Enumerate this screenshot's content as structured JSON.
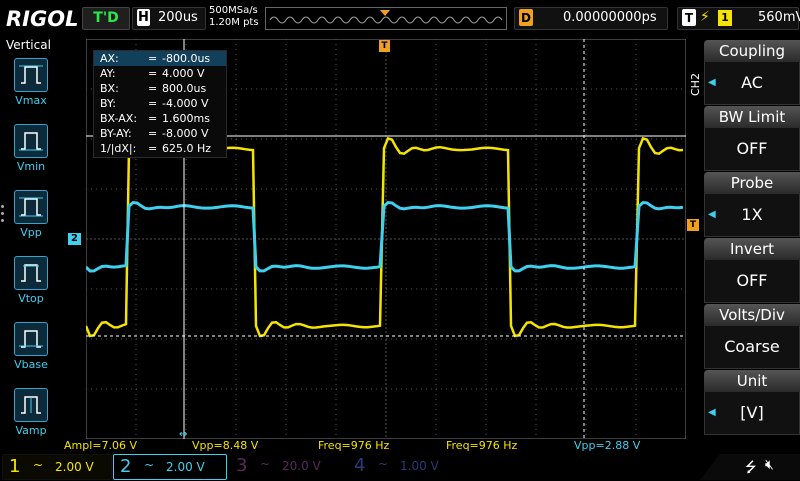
{
  "topbar": {
    "brand": "RIGOL",
    "trigger_status": "T'D",
    "horizontal_key": "H",
    "timebase": "200us",
    "sample_rate": "500MSa/s",
    "memory_depth": "1.20M pts",
    "delay_key": "D",
    "delay_value": "0.00000000ps",
    "trigger_key": "T",
    "trigger_source": "1",
    "trigger_level": "560mV"
  },
  "left_menu": {
    "title": "Vertical",
    "items": [
      {
        "label": "Vmax",
        "icon": "vmax-icon"
      },
      {
        "label": "Vmin",
        "icon": "vmin-icon"
      },
      {
        "label": "Vpp",
        "icon": "vpp-icon"
      },
      {
        "label": "Vtop",
        "icon": "vtop-icon"
      },
      {
        "label": "Vbase",
        "icon": "vbase-icon"
      },
      {
        "label": "Vamp",
        "icon": "vamp-icon"
      }
    ]
  },
  "cursor_table": {
    "rows": [
      {
        "k": "AX:",
        "v": "-800.0us"
      },
      {
        "k": "AY:",
        "v": "4.000 V"
      },
      {
        "k": "BX:",
        "v": "800.0us"
      },
      {
        "k": "BY:",
        "v": "-4.000 V"
      },
      {
        "k": "BX-AX:",
        "v": "1.600ms"
      },
      {
        "k": "BY-AY:",
        "v": "-8.000 V"
      },
      {
        "k": "1/|dX|:",
        "v": "625.0 Hz"
      }
    ],
    "eq": "="
  },
  "markers": {
    "ch2_marker": "2",
    "trigger_marker": "T"
  },
  "measurements": [
    {
      "text": "Ampl=7.06 V",
      "channel": 1
    },
    {
      "text": "Vpp=8.48 V",
      "channel": 1
    },
    {
      "text": "Freq=976 Hz",
      "channel": 1
    },
    {
      "text": "Freq=976 Hz",
      "channel": 1
    },
    {
      "text": "Vpp=2.88 V",
      "channel": 2
    }
  ],
  "channels": [
    {
      "num": "1",
      "coupling": "~",
      "scale": "2.00 V",
      "color": "#f5e400",
      "active": true
    },
    {
      "num": "2",
      "coupling": "~",
      "scale": "2.00 V",
      "color": "#3fd0f0",
      "active": true
    },
    {
      "num": "3",
      "coupling": "~",
      "scale": "20.0 V",
      "color": "#b040b0",
      "active": false
    },
    {
      "num": "4",
      "coupling": "~",
      "scale": "1.00 V",
      "color": "#4060d0",
      "active": false
    }
  ],
  "right_menu": {
    "channel_tab": "CH2",
    "items": [
      {
        "title": "Coupling",
        "value": "AC"
      },
      {
        "title": "BW Limit",
        "value": "OFF"
      },
      {
        "title": "Probe",
        "value": "1X"
      },
      {
        "title": "Invert",
        "value": "OFF"
      },
      {
        "title": "Volts/Div",
        "value": "Coarse"
      },
      {
        "title": "Unit",
        "value": "[V]"
      }
    ]
  },
  "colors": {
    "ch1": "#f5e400",
    "ch2": "#3fd0f0",
    "accent_orange": "#f0a020",
    "grid": "#555555"
  }
}
